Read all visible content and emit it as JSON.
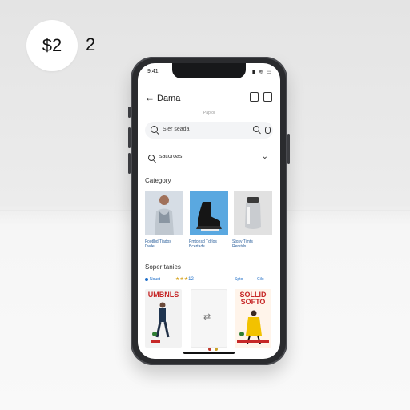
{
  "overlay": {
    "price": "$2",
    "count": "2"
  },
  "phone": {
    "status": {
      "time": "9:41",
      "icons": "▮ ≋ ▭"
    },
    "header": {
      "back_icon": "back-arrow-icon",
      "title": "Dama",
      "caption": "Paptol"
    },
    "search": {
      "placeholder": "Sier seada"
    },
    "filter": {
      "label": "sacoroas"
    },
    "categories": {
      "title": "Category",
      "items": [
        {
          "label": "Footlbd Tiados\nDvde"
        },
        {
          "label": "Pmtonsd Tdrlos\nBcertads"
        },
        {
          "label": "Stosy Timts\nRerstds"
        }
      ]
    },
    "featured": {
      "title": "Soper tanies",
      "meta_left": "Noust",
      "rating_stars": "★★★",
      "rating_count": "12",
      "meta_right_1": "Spto",
      "meta_right_2": "Cilo",
      "posters": [
        {
          "title": "UMBNLS"
        },
        {
          "title": ""
        },
        {
          "title": "SOLLID\nSOFTO"
        }
      ]
    }
  }
}
